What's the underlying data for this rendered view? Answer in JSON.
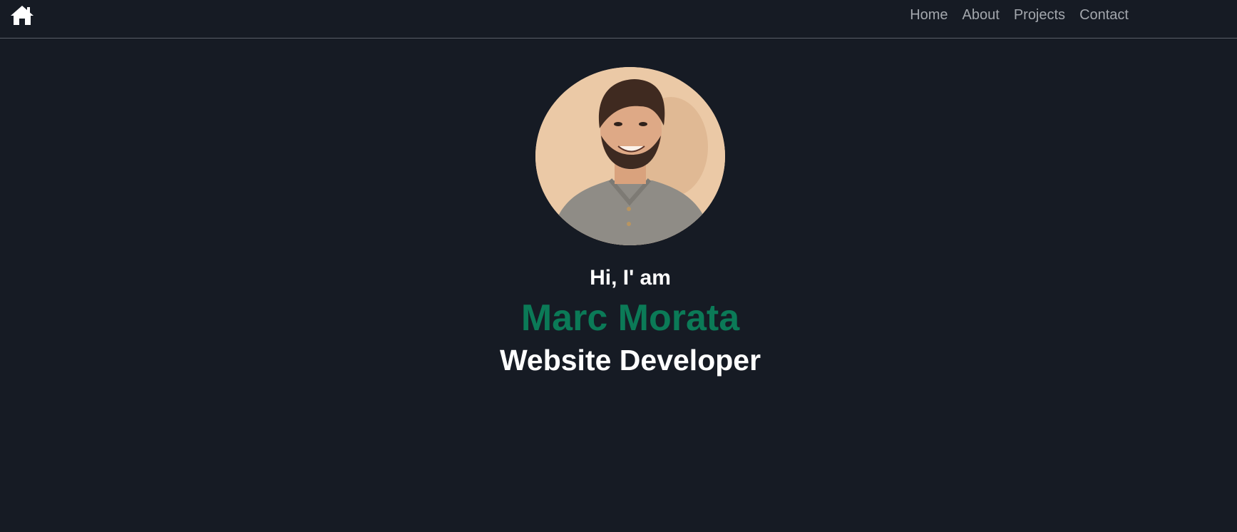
{
  "header": {
    "home_icon": "home-icon",
    "nav": [
      {
        "label": "Home"
      },
      {
        "label": "About"
      },
      {
        "label": "Projects"
      },
      {
        "label": "Contact"
      }
    ]
  },
  "hero": {
    "avatar_icon": "profile-photo",
    "greeting": "Hi, I' am",
    "name": "Marc Morata",
    "role": "Website Developer"
  },
  "colors": {
    "background": "#161b24",
    "nav_text": "#a3a7ad",
    "accent": "#0b7a57",
    "text": "#ffffff",
    "divider": "#5b6068"
  }
}
